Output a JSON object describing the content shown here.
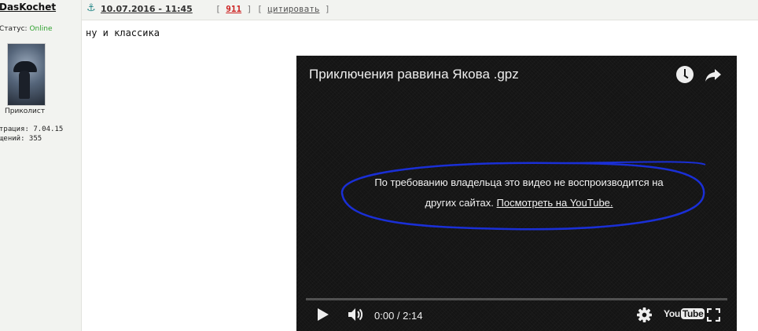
{
  "user": {
    "name": "DasKochet",
    "status_label": "Статус:",
    "status_value": "Online",
    "rank": "Приколист",
    "reg_text": "трация: 7.04.15",
    "posts_text": "щений: 355"
  },
  "post": {
    "date": "10.07.2016 - 11:45",
    "bracket_open": "[",
    "number": "911",
    "bracket_mid": "] [",
    "quote_label": "цитировать",
    "bracket_close": "]",
    "message": "ну и классика"
  },
  "video": {
    "title": "Приключения раввина Якова .gpz",
    "notice_line1": "По требованию владельца это видео не воспроизводится на",
    "notice_line2": "других сайтах.",
    "link_text": "Посмотреть на YouTube.",
    "time": "0:00 / 2:14",
    "logo_you": "You",
    "logo_tube": "Tube",
    "progress": 0
  },
  "icons": {
    "anchor": "anchor-icon",
    "clock": "watch-later-icon",
    "share": "share-icon",
    "play": "play-icon",
    "volume": "volume-icon",
    "settings": "gear-icon",
    "fullscreen": "fullscreen-icon"
  },
  "colors": {
    "online": "#2fa12f",
    "post_number": "#cc1f1f",
    "annotation_ellipse": "#1a2fd6",
    "player_bg": "#141414"
  }
}
